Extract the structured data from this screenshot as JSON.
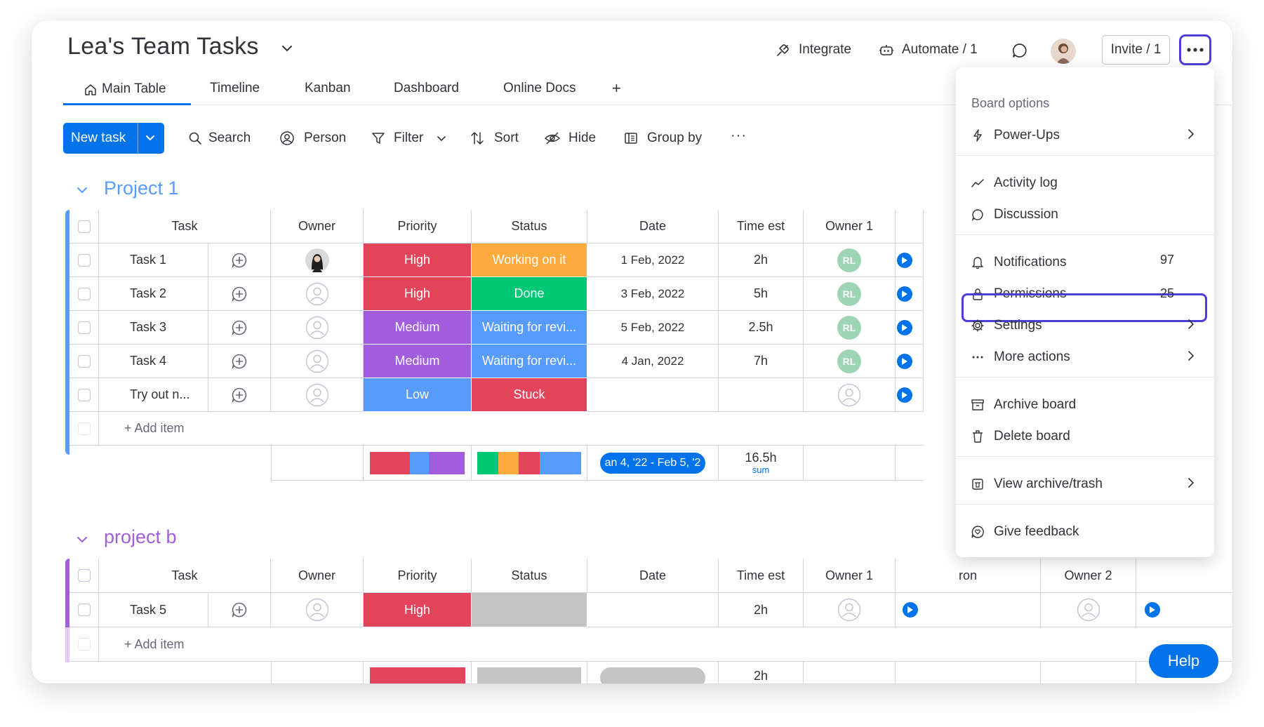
{
  "board": {
    "title": "Lea's Team Tasks",
    "integrate_label": "Integrate",
    "automate_label": "Automate / 1",
    "invite_label": "Invite / 1"
  },
  "tabs": [
    {
      "label": "Main Table",
      "active": true
    },
    {
      "label": "Timeline"
    },
    {
      "label": "Kanban"
    },
    {
      "label": "Dashboard"
    },
    {
      "label": "Online Docs"
    },
    {
      "label": "+"
    }
  ],
  "toolbar": {
    "new_task": "New task",
    "search": "Search",
    "person": "Person",
    "filter": "Filter",
    "sort": "Sort",
    "hide": "Hide",
    "group_by": "Group by",
    "more": "···"
  },
  "colors": {
    "primary": "#0073ea",
    "high": "#e2445c",
    "medium": "#a25ddc",
    "low": "#579bfc",
    "working": "#fdab3d",
    "done": "#00c875",
    "waiting": "#579bfc",
    "stuck": "#e2445c",
    "empty": "#c4c4c4",
    "group1": "#579bfc",
    "group2": "#a25ddc",
    "highlight": "#4c3fd8"
  },
  "group1": {
    "title": "Project 1",
    "columns": [
      "Task",
      "Owner",
      "Priority",
      "Status",
      "Date",
      "Time est",
      "Owner 1"
    ],
    "rows": [
      {
        "task": "Task 1",
        "priority": "High",
        "status": "Working on it",
        "date": "1 Feb, 2022",
        "time": "2h",
        "owner1": "RL",
        "extra": "97"
      },
      {
        "task": "Task 2",
        "priority": "High",
        "status": "Done",
        "date": "3 Feb, 2022",
        "time": "5h",
        "owner1": "RL",
        "extra": "25"
      },
      {
        "task": "Task 3",
        "priority": "Medium",
        "status": "Waiting for revi...",
        "date": "5 Feb, 2022",
        "time": "2.5h",
        "owner1": "RL",
        "extra": ""
      },
      {
        "task": "Task 4",
        "priority": "Medium",
        "status": "Waiting for revi...",
        "date": "4 Jan, 2022",
        "time": "7h",
        "owner1": "RL",
        "extra": ""
      },
      {
        "task": "Try out n...",
        "priority": "Low",
        "status": "Stuck",
        "date": "",
        "time": "",
        "owner1": "",
        "extra": ""
      }
    ],
    "add_item": "+ Add item",
    "summary": {
      "date_range": "an 4, '22 - Feb 5, '2",
      "time_sum": "16.5h",
      "sum_label": "sum"
    }
  },
  "group2": {
    "title": "project b",
    "columns": [
      "Task",
      "Owner",
      "Priority",
      "Status",
      "Date",
      "Time est",
      "Owner 1",
      "ron",
      "Owner 2"
    ],
    "rows": [
      {
        "task": "Task 5",
        "priority": "High",
        "status": "",
        "date": "",
        "time": "2h"
      }
    ],
    "add_item": "+ Add item",
    "summary": {
      "time_sum": "2h"
    }
  },
  "menu": {
    "heading": "Board options",
    "items": [
      {
        "label": "Power-Ups",
        "icon": "bolt-icon",
        "submenu": true
      },
      {
        "label": "Activity log",
        "icon": "activity-icon"
      },
      {
        "label": "Discussion",
        "icon": "chat-icon"
      },
      {
        "label": "Notifications",
        "icon": "bell-icon"
      },
      {
        "label": "Permissions",
        "icon": "lock-icon",
        "highlighted": true
      },
      {
        "label": "Settings",
        "icon": "gear-icon",
        "submenu": true
      },
      {
        "label": "More actions",
        "icon": "dots-icon",
        "submenu": true
      },
      {
        "label": "Archive board",
        "icon": "archive-icon"
      },
      {
        "label": "Delete board",
        "icon": "trash-icon"
      },
      {
        "label": "View archive/trash",
        "icon": "archive-trash-icon",
        "submenu": true
      },
      {
        "label": "Give feedback",
        "icon": "feedback-icon"
      }
    ]
  },
  "help_label": "Help"
}
